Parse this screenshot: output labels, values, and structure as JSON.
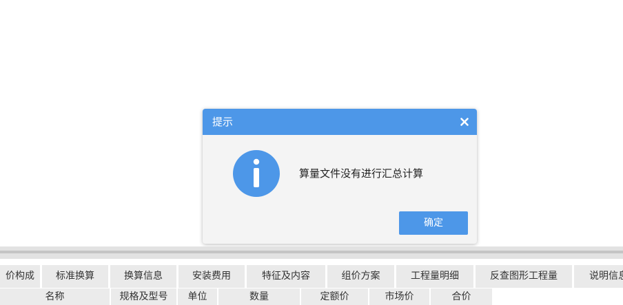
{
  "dialog": {
    "title": "提示",
    "close_symbol": "✕",
    "icon": "info-icon",
    "message": "算量文件没有进行汇总计算",
    "ok_label": "确定",
    "accent_color": "#4d97e8"
  },
  "tabs": [
    {
      "label": "价构成",
      "icon": null
    },
    {
      "label": "标准换算"
    },
    {
      "label": "换算信息"
    },
    {
      "label": "安装费用"
    },
    {
      "label": "特征及内容"
    },
    {
      "label": "组价方案"
    },
    {
      "label": "工程量明细"
    },
    {
      "label": "反查图形工程量"
    },
    {
      "label": "说明信息"
    }
  ],
  "table": {
    "columns": [
      "名称",
      "规格及型号",
      "单位",
      "数量",
      "定额价",
      "市场价",
      "合价"
    ]
  }
}
